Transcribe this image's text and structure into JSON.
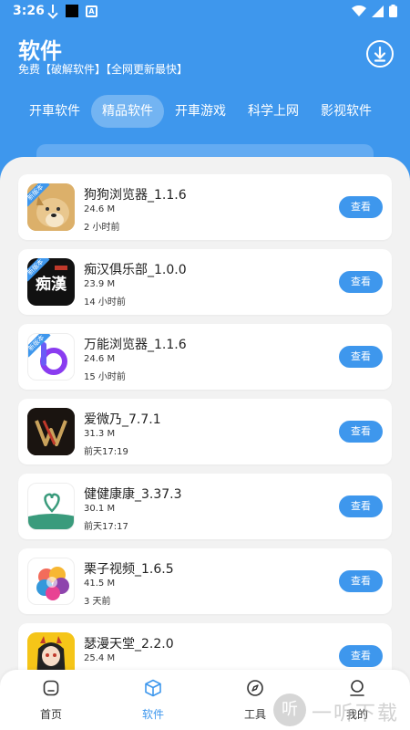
{
  "status_bar": {
    "time": "3:26"
  },
  "header": {
    "title": "软件",
    "subtitle": "免费【破解软件】【全网更新最快】"
  },
  "tabs": [
    {
      "label": "开車软件",
      "active": false
    },
    {
      "label": "精品软件",
      "active": true
    },
    {
      "label": "开車游戏",
      "active": false
    },
    {
      "label": "科学上网",
      "active": false
    },
    {
      "label": "影视软件",
      "active": false
    }
  ],
  "badge_text": "新版本",
  "apps": [
    {
      "name": "狗狗浏览器_1.1.6",
      "size": "24.6 M",
      "time": "2 小时前",
      "button": "查看",
      "badge": true,
      "icon": "doge-icon"
    },
    {
      "name": "痴汉俱乐部_1.0.0",
      "size": "23.9 M",
      "time": "14 小时前",
      "button": "查看",
      "badge": true,
      "icon": "chihan-icon",
      "icon_text": "痴漢"
    },
    {
      "name": "万能浏览器_1.1.6",
      "size": "24.6 M",
      "time": "15 小时前",
      "button": "查看",
      "badge": true,
      "icon": "b-logo-icon"
    },
    {
      "name": "爱微乃_7.7.1",
      "size": "31.3 M",
      "time": "前天17:19",
      "button": "查看",
      "badge": false,
      "icon": "w-logo-icon"
    },
    {
      "name": "健健康康_3.37.3",
      "size": "30.1 M",
      "time": "前天17:17",
      "button": "查看",
      "badge": false,
      "icon": "heart-icon"
    },
    {
      "name": "栗子视频_1.6.5",
      "size": "41.5 M",
      "time": "3 天前",
      "button": "查看",
      "badge": false,
      "icon": "flower-icon"
    },
    {
      "name": "瑟漫天堂_2.2.0",
      "size": "25.4 M",
      "time": "",
      "button": "查看",
      "badge": false,
      "icon": "anime-girl-icon"
    }
  ],
  "bottom_nav": [
    {
      "label": "首页",
      "icon": "home-icon",
      "active": false
    },
    {
      "label": "软件",
      "icon": "box-icon",
      "active": true
    },
    {
      "label": "工具",
      "icon": "compass-icon",
      "active": false
    },
    {
      "label": "我的",
      "icon": "user-icon",
      "active": false
    }
  ],
  "watermark": {
    "glyph": "听",
    "text": "一听下载"
  },
  "colors": {
    "accent": "#3e97ed",
    "background": "#f2f2f2"
  }
}
